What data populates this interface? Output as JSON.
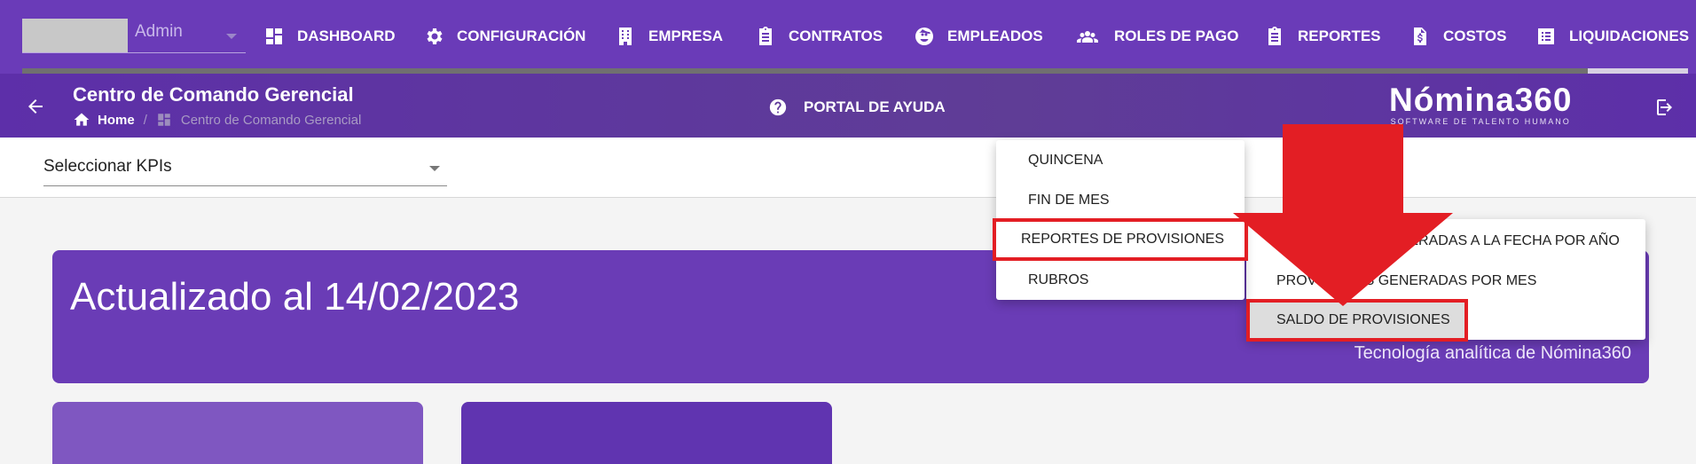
{
  "user": {
    "name": "Admin"
  },
  "nav": {
    "items": [
      {
        "label": "DASHBOARD",
        "icon": "dashboard-icon"
      },
      {
        "label": "CONFIGURACIÓN",
        "icon": "gear-icon"
      },
      {
        "label": "EMPRESA",
        "icon": "building-icon"
      },
      {
        "label": "CONTRATOS",
        "icon": "clipboard-icon"
      },
      {
        "label": "EMPLEADOS",
        "icon": "face-icon"
      },
      {
        "label": "ROLES DE PAGO",
        "icon": "people-icon"
      },
      {
        "label": "REPORTES",
        "icon": "clipboard-icon"
      },
      {
        "label": "COSTOS",
        "icon": "dollar-file-icon"
      },
      {
        "label": "LIQUIDACIONES",
        "icon": "list-icon"
      }
    ],
    "progress_fraction": 0.94
  },
  "header": {
    "title": "Centro de Comando Gerencial",
    "breadcrumb": {
      "home": "Home",
      "separator": "/",
      "current": "Centro de Comando Gerencial"
    },
    "help_label": "PORTAL DE AYUDA",
    "brand_name": "Nómina360",
    "brand_tagline": "SOFTWARE DE TALENTO HUMANO"
  },
  "kpi": {
    "label": "Seleccionar KPIs"
  },
  "banner": {
    "title": "Actualizado al 14/02/2023",
    "subtitle": "Tecnología analítica de Nómina360"
  },
  "menu": {
    "items": [
      "QUINCENA",
      "FIN DE MES",
      "REPORTES DE PROVISIONES",
      "RUBROS"
    ],
    "highlighted": "REPORTES DE PROVISIONES",
    "submenu": [
      "PROVISIONES GENERADAS A LA FECHA POR AÑO",
      "PROVISIONES GENERADAS POR MES",
      "SALDO DE PROVISIONES"
    ],
    "submenu_selected": "SALDO DE PROVISIONES"
  },
  "annotation": {
    "highlight_color": "#e31e24"
  }
}
